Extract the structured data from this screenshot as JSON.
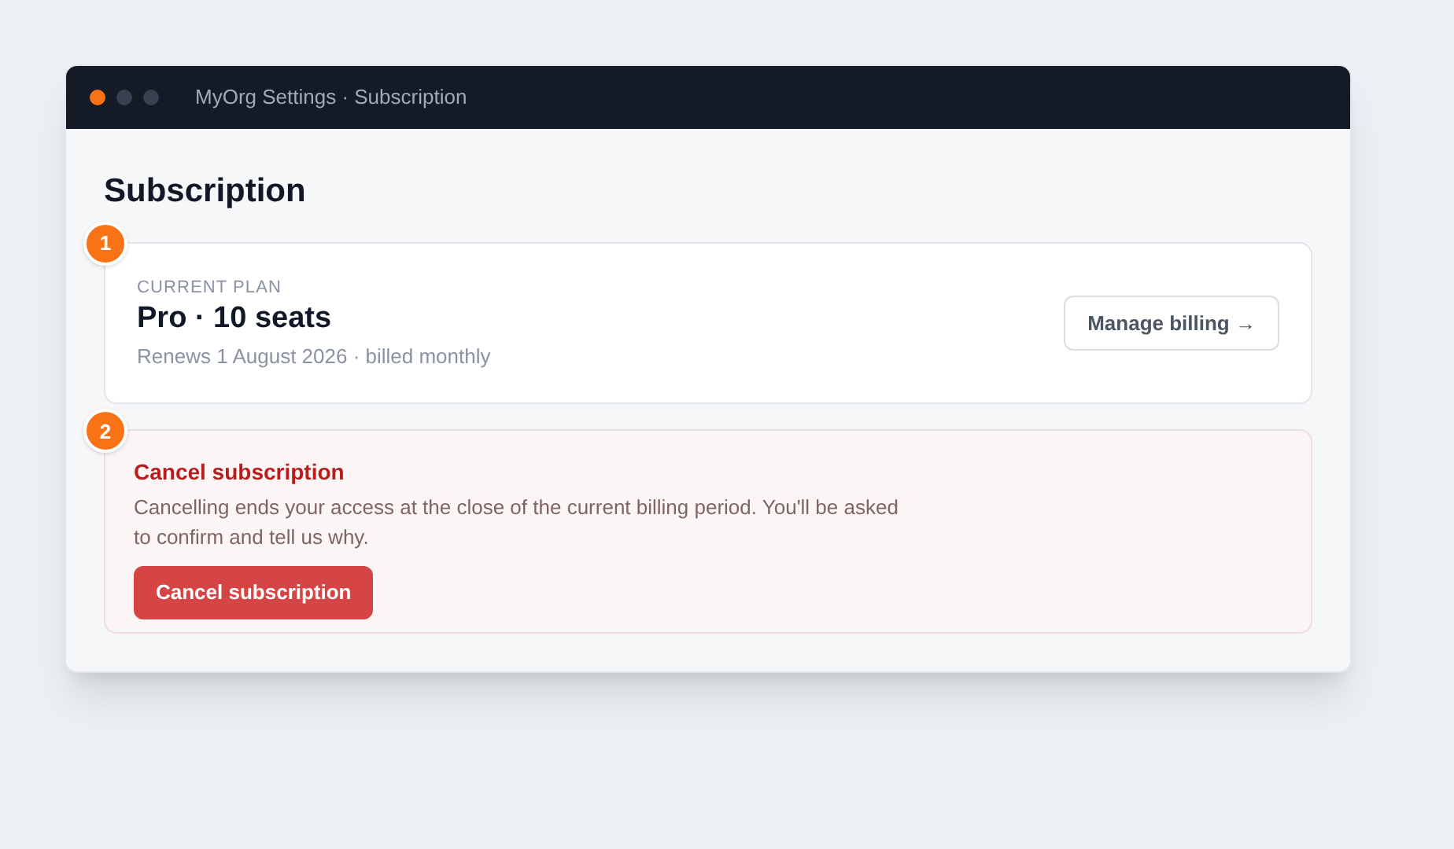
{
  "window": {
    "title": "MyOrg Settings · Subscription",
    "dots": [
      {
        "color": "#f97316"
      },
      {
        "color": "#374151"
      },
      {
        "color": "#374151"
      }
    ]
  },
  "heading": "Subscription",
  "plan_card": {
    "step": "1",
    "eyebrow": "CURRENT PLAN",
    "plan": "Pro · 10 seats",
    "renewal": "Renews 1 August 2026 · billed monthly",
    "button": "Manage billing →"
  },
  "cancel_card": {
    "step": "2",
    "title": "Cancel subscription",
    "description": "Cancelling ends your access at the close of the current billing period. You'll be asked to confirm and tell us why.",
    "button": "Cancel subscription"
  }
}
